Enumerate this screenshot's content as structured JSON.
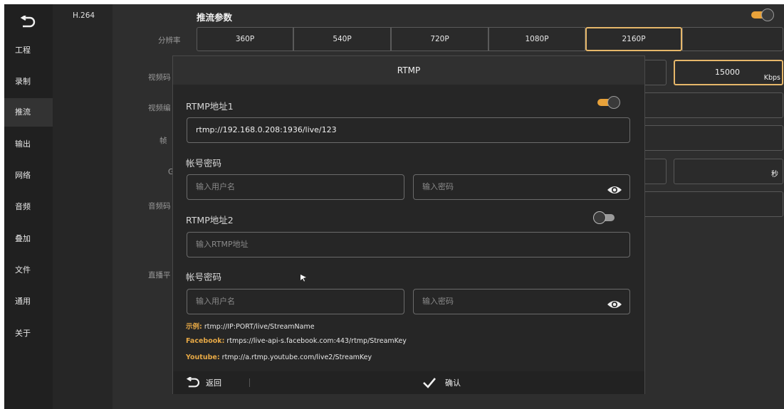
{
  "sidebar": {
    "items": [
      {
        "label": "工程"
      },
      {
        "label": "录制"
      },
      {
        "label": "推流"
      },
      {
        "label": "输出"
      },
      {
        "label": "网络"
      },
      {
        "label": "音频"
      },
      {
        "label": "叠加"
      },
      {
        "label": "文件"
      },
      {
        "label": "通用"
      },
      {
        "label": "关于"
      }
    ]
  },
  "subcol": {
    "codec": "H.264"
  },
  "main": {
    "section_title": "推流参数",
    "labels": {
      "resolution": "分辨率",
      "video_bitrate": "视频码",
      "video_encoder": "视频编",
      "frame": "帧",
      "gop": "G",
      "audio": "音频码",
      "live": "直播平"
    },
    "resolutions": [
      "360P",
      "540P",
      "720P",
      "1080P",
      "2160P"
    ],
    "bitrate_value": "15000",
    "bitrate_unit": "Kbps",
    "gop_unit": "秒"
  },
  "modal": {
    "title": "RTMP",
    "rtmp1_label": "RTMP地址1",
    "rtmp1_value": "rtmp://192.168.0.208:1936/live/123",
    "account1_label": "帐号密码",
    "user_placeholder_1": "输入用户名",
    "pass_placeholder_1": "输入密码",
    "rtmp2_label": "RTMP地址2",
    "rtmp2_placeholder": "输入RTMP地址",
    "account2_label": "帐号密码",
    "user_placeholder_2": "输入用户名",
    "pass_placeholder_2": "输入密码",
    "examples": [
      {
        "key": "示例:",
        "value": " rtmp://IP:PORT/live/StreamName"
      },
      {
        "key": "Facebook:",
        "value": " rtmps://live-api-s.facebook.com:443/rtmp/StreamKey"
      },
      {
        "key": "Youtube:",
        "value": " rtmp://a.rtmp.youtube.com/live2/StreamKey"
      }
    ],
    "footer": {
      "back": "返回",
      "confirm": "确认"
    }
  },
  "colors": {
    "accent": "#e6b76a",
    "toggle_on": "#e8a23a",
    "background": "#2e2e2e"
  }
}
